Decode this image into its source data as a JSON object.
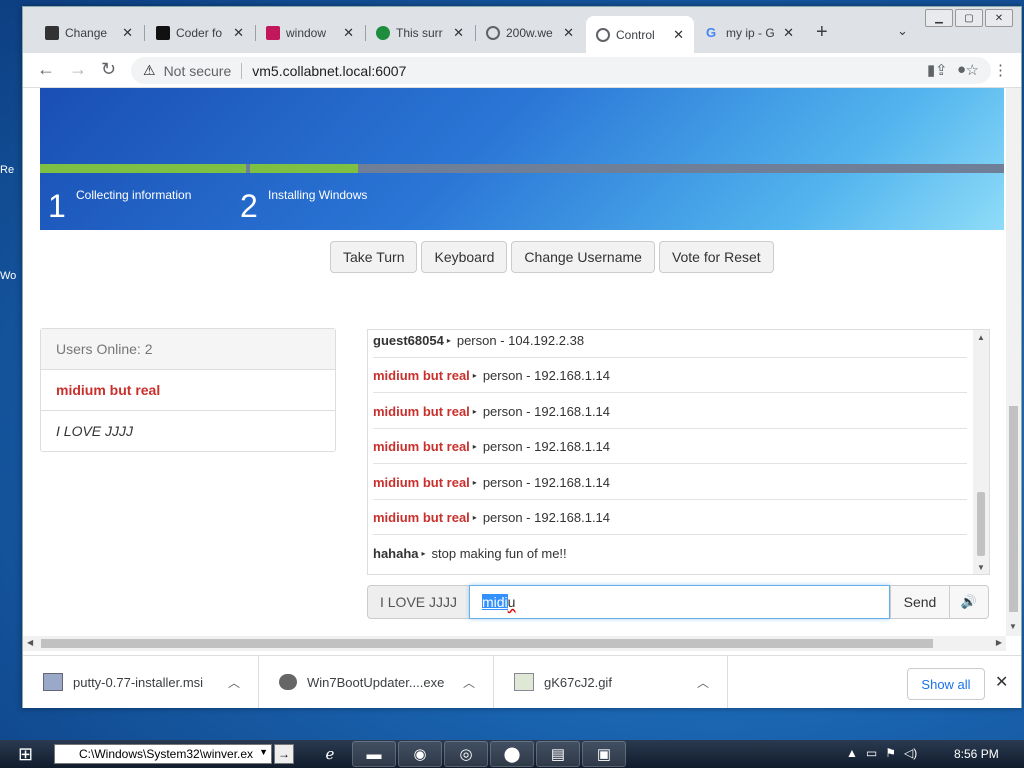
{
  "tabs": [
    {
      "label": "Change",
      "favicon_color": "#333333"
    },
    {
      "label": "Coder fo",
      "favicon_color": "#111111"
    },
    {
      "label": "window",
      "favicon_color": "#c2185b"
    },
    {
      "label": "This surr",
      "favicon_color": "#1e8e3e"
    },
    {
      "label": "200w.we",
      "favicon_color": "#5f6368"
    },
    {
      "label": "Control",
      "favicon_color": "#5f6368"
    },
    {
      "label": "my ip - G",
      "favicon_color": "#4285f4"
    }
  ],
  "toolbar": {
    "not_secure": "Not secure",
    "url": "vm5.collabnet.local:6007"
  },
  "vm": {
    "step1_num": "1",
    "step1_text": "Collecting information",
    "step2_num": "2",
    "step2_text": "Installing Windows"
  },
  "controls": {
    "take_turn": "Take Turn",
    "keyboard": "Keyboard",
    "change_username": "Change Username",
    "vote_reset": "Vote for Reset"
  },
  "users": {
    "header": "Users Online: 2",
    "list": [
      "midium but real",
      "I LOVE JJJJ"
    ]
  },
  "chat": {
    "messages": [
      {
        "user": "guest68054",
        "text": "person - 104.192.2.38",
        "highlight": false
      },
      {
        "user": "midium but real",
        "text": "person - 192.168.1.14",
        "highlight": true
      },
      {
        "user": "midium but real",
        "text": "person - 192.168.1.14",
        "highlight": true
      },
      {
        "user": "midium but real",
        "text": "person - 192.168.1.14",
        "highlight": true
      },
      {
        "user": "midium but real",
        "text": "person - 192.168.1.14",
        "highlight": true
      },
      {
        "user": "midium but real",
        "text": "person - 192.168.1.14",
        "highlight": true
      },
      {
        "user": "hahaha",
        "text": "stop making fun of me!!",
        "highlight": false
      }
    ],
    "username_label": "I LOVE JJJJ",
    "input_selected": "midi",
    "input_rest": "u",
    "send": "Send"
  },
  "downloads": {
    "items": [
      "putty-0.77-installer.msi",
      "Win7BootUpdater....exe",
      "gK67cJ2.gif"
    ],
    "show_all": "Show all"
  },
  "taskbar": {
    "run_path": "C:\\Windows\\System32\\winver.ex",
    "clock": "8:56 PM"
  },
  "desktop": {
    "frag1": "Re",
    "frag2": "Wo"
  },
  "colors": {
    "accent_red": "#c9302c",
    "progress_green": "#7ec043",
    "link_blue": "#1a73e8"
  }
}
